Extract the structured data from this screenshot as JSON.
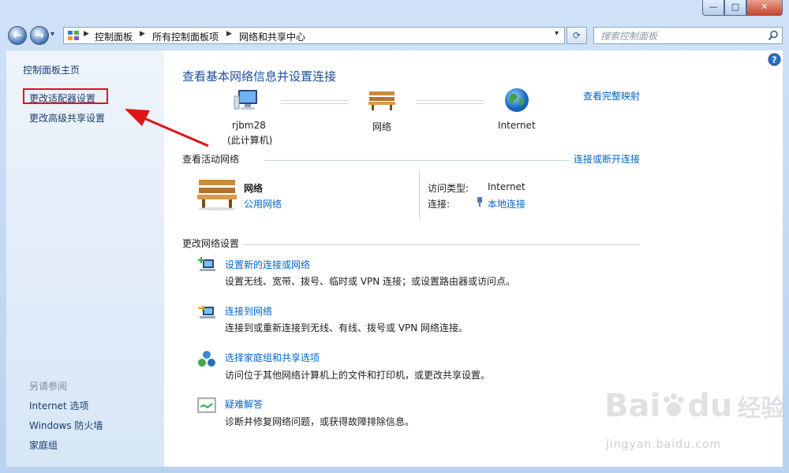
{
  "window": {
    "min_glyph": "—",
    "max_glyph": "□",
    "close_glyph": "✕"
  },
  "nav": {
    "back_glyph": "←",
    "forward_glyph": "→",
    "dropdown_glyph": "▾",
    "refresh_glyph": "⟳",
    "breadcrumb": [
      "控制面板",
      "所有控制面板项",
      "网络和共享中心"
    ],
    "search_placeholder": "搜索控制面板"
  },
  "sidebar": {
    "home": "控制面板主页",
    "links": [
      "更改适配器设置",
      "更改高级共享设置"
    ],
    "see_also_title": "另请参阅",
    "see_also": [
      "Internet 选项",
      "Windows 防火墙",
      "家庭组"
    ]
  },
  "main": {
    "title": "查看基本网络信息并设置连接",
    "view_full_map": "查看完整映射",
    "map": {
      "computer_name": "rjbm28",
      "computer_sub": "(此计算机)",
      "network_label": "网络",
      "internet_label": "Internet"
    },
    "active_networks": {
      "section_title": "查看活动网络",
      "connect_disconnect": "连接或断开连接",
      "network_name": "网络",
      "network_type": "公用网络",
      "access_type_label": "访问类型:",
      "access_type_value": "Internet",
      "connection_label": "连接:",
      "connection_value": "本地连接"
    },
    "change_settings": {
      "section_title": "更改网络设置",
      "tasks": [
        {
          "link": "设置新的连接或网络",
          "desc": "设置无线、宽带、拨号、临时或 VPN 连接；或设置路由器或访问点。"
        },
        {
          "link": "连接到网络",
          "desc": "连接到或重新连接到无线、有线、拨号或 VPN 网络连接。"
        },
        {
          "link": "选择家庭组和共享选项",
          "desc": "访问位于其他网络计算机上的文件和打印机，或更改共享设置。"
        },
        {
          "link": "疑难解答",
          "desc": "诊断并修复网络问题，或获得故障排除信息。"
        }
      ]
    }
  },
  "watermark": {
    "brand": "Bai",
    "brand_suffix": "du",
    "cn": "经验",
    "url": "jingyan.baidu.com"
  },
  "colors": {
    "link": "#0066cc",
    "title": "#1f4e9c",
    "highlight_box": "#e01414",
    "arrow": "#e01414"
  }
}
